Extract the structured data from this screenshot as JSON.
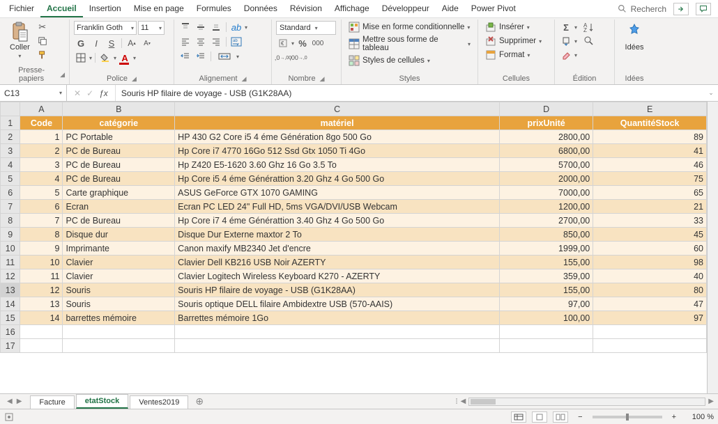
{
  "menu": {
    "items": [
      "Fichier",
      "Accueil",
      "Insertion",
      "Mise en page",
      "Formules",
      "Données",
      "Révision",
      "Affichage",
      "Développeur",
      "Aide",
      "Power Pivot"
    ],
    "active_index": 1,
    "search_placeholder": "Recherch"
  },
  "ribbon": {
    "clipboard": {
      "label": "Presse-papiers",
      "paste": "Coller"
    },
    "font": {
      "label": "Police",
      "name": "Franklin Goth",
      "size": "11",
      "bold": "G",
      "italic": "I",
      "underline": "S"
    },
    "alignment": {
      "label": "Alignement"
    },
    "number": {
      "label": "Nombre",
      "format": "Standard"
    },
    "styles": {
      "label": "Styles",
      "conditional": "Mise en forme conditionnelle",
      "astable": "Mettre sous forme de tableau",
      "cellstyles": "Styles de cellules"
    },
    "cells": {
      "label": "Cellules",
      "insert": "Insérer",
      "delete": "Supprimer",
      "format": "Format"
    },
    "editing": {
      "label": "Édition"
    },
    "ideas": {
      "label": "Idées",
      "btn": "Idées"
    }
  },
  "namebox": "C13",
  "formula": "Souris HP filaire de voyage - USB (G1K28AA)",
  "columns": [
    "A",
    "B",
    "C",
    "D",
    "E"
  ],
  "headers": {
    "A": "Code",
    "B": "catégorie",
    "C": "matériel",
    "D": "prixUnité",
    "E": "QuantitéStock"
  },
  "rows": [
    {
      "n": 2,
      "code": "1",
      "cat": "PC Portable",
      "mat": "HP 430 G2 Core i5 4 éme Génération 8go 500 Go",
      "prix": "2800,00",
      "qte": "89"
    },
    {
      "n": 3,
      "code": "2",
      "cat": "PC de Bureau",
      "mat": "Hp Core i7 4770 16Go 512 Ssd Gtx 1050 Ti 4Go",
      "prix": "6800,00",
      "qte": "41"
    },
    {
      "n": 4,
      "code": "3",
      "cat": "PC de Bureau",
      "mat": "Hp Z420 E5-1620 3.60 Ghz 16 Go 3.5 To",
      "prix": "5700,00",
      "qte": "46"
    },
    {
      "n": 5,
      "code": "4",
      "cat": "PC de Bureau",
      "mat": "Hp Core i5 4 éme Générattion 3.20 Ghz 4 Go 500 Go",
      "prix": "2000,00",
      "qte": "75"
    },
    {
      "n": 6,
      "code": "5",
      "cat": "Carte graphique",
      "mat": "ASUS GeForce GTX 1070 GAMING",
      "prix": "7000,00",
      "qte": "65"
    },
    {
      "n": 7,
      "code": "6",
      "cat": "Ecran",
      "mat": "Ecran PC LED 24\" Full HD, 5ms VGA/DVI/USB Webcam",
      "prix": "1200,00",
      "qte": "21"
    },
    {
      "n": 8,
      "code": "7",
      "cat": "PC de Bureau",
      "mat": "Hp Core i7 4 éme Générattion 3.40 Ghz 4 Go 500 Go",
      "prix": "2700,00",
      "qte": "33"
    },
    {
      "n": 9,
      "code": "8",
      "cat": "Disque dur",
      "mat": "Disque Dur Externe maxtor 2 To",
      "prix": "850,00",
      "qte": "45"
    },
    {
      "n": 10,
      "code": "9",
      "cat": "Imprimante",
      "mat": "Canon maxify MB2340 Jet d'encre",
      "prix": "1999,00",
      "qte": "60"
    },
    {
      "n": 11,
      "code": "10",
      "cat": "Clavier",
      "mat": "Clavier Dell KB216 USB Noir AZERTY",
      "prix": "155,00",
      "qte": "98"
    },
    {
      "n": 12,
      "code": "11",
      "cat": "Clavier",
      "mat": "Clavier Logitech Wireless Keyboard K270 - AZERTY",
      "prix": "359,00",
      "qte": "40"
    },
    {
      "n": 13,
      "code": "12",
      "cat": "Souris",
      "mat": "Souris HP filaire de voyage - USB (G1K28AA)",
      "prix": "155,00",
      "qte": "80"
    },
    {
      "n": 14,
      "code": "13",
      "cat": "Souris",
      "mat": "Souris optique DELL filaire Ambidextre USB (570-AAIS)",
      "prix": "97,00",
      "qte": "47"
    },
    {
      "n": 15,
      "code": "14",
      "cat": "barrettes mémoire",
      "mat": "Barrettes mémoire 1Go",
      "prix": "100,00",
      "qte": "97"
    }
  ],
  "empty_rows": [
    16,
    17
  ],
  "sheets": {
    "tabs": [
      "Facture",
      "etatStock",
      "Ventes2019"
    ],
    "active_index": 1
  },
  "status": {
    "zoom": "100 %"
  }
}
